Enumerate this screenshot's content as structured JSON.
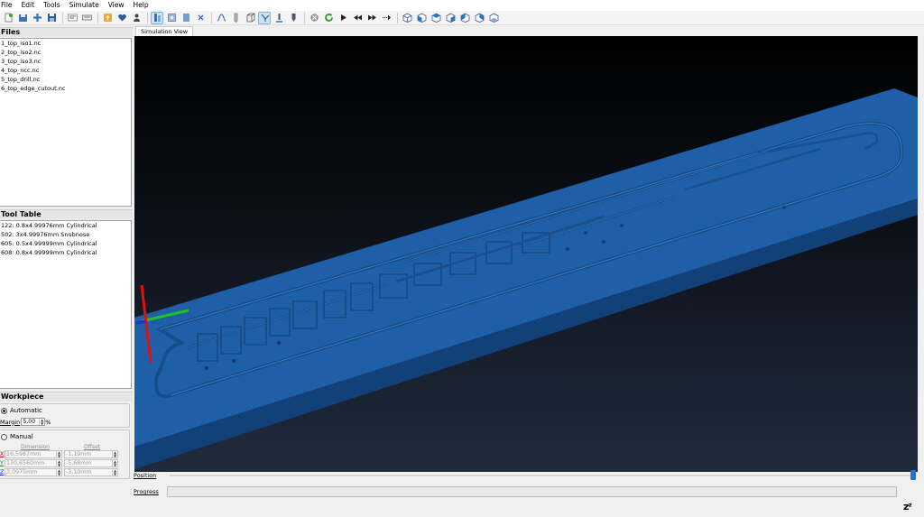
{
  "menu": [
    "File",
    "Edit",
    "Tools",
    "Simulate",
    "View",
    "Help"
  ],
  "toolbar": {
    "buttons": [
      "new-icon",
      "save-icon",
      "add-icon",
      "disk-icon",
      "gcode-icon",
      "keyboard-icon",
      "settings-icon",
      "heart-icon",
      "person-icon",
      "tool-icon",
      "workpiece-icon",
      "block-icon",
      "close-icon",
      "path-icon",
      "pencil-icon",
      "box-icon",
      "axes-icon",
      "endmill-icon",
      "drill-icon",
      "stop-icon",
      "reload-icon",
      "play-icon",
      "rewind-icon",
      "fast-forward-icon",
      "step-icon",
      "view-iso-icon",
      "view-front-icon",
      "view-top-icon",
      "view-left-icon",
      "view-right-icon",
      "view-back-icon",
      "view-bottom-icon"
    ],
    "accent": "#2a74c8"
  },
  "files": {
    "title": "Files",
    "items": [
      "1_top_iso1.nc",
      "2_top_iso2.nc",
      "3_top_iso3.nc",
      "4_top_ncc.nc",
      "5_top_drill.nc",
      "6_top_edge_cutout.nc"
    ]
  },
  "tools": {
    "title": "Tool Table",
    "items": [
      "122: 0.8x4.99976mm Cylindrical",
      "502: 3x4.99976mm Snubnose",
      "605: 0.5x4.99999mm Cylindrical",
      "608: 0.8x4.99999mm Cylindrical"
    ]
  },
  "workpiece": {
    "title": "Workpiece",
    "automatic_label": "Automatic",
    "margin_label": "Margin",
    "margin_value": "5,00",
    "margin_unit": "%",
    "manual_label": "Manual",
    "dimension_header": "Dimension",
    "offset_header": "Offset",
    "rows": [
      {
        "axis": "X",
        "dimension": "16,5987mm",
        "offset": "-1,19mm"
      },
      {
        "axis": "Y",
        "dimension": "130,6560mm",
        "offset": "-5,68mm"
      },
      {
        "axis": "Z",
        "dimension": "3,0975mm",
        "offset": "-3,10mm"
      }
    ]
  },
  "simulation": {
    "tab_label": "Simulation View",
    "board_color": "#1f5fa8"
  },
  "bottom": {
    "position_label": "Position",
    "position_value": 1.0,
    "progress_label": "Progress",
    "progress_value": 0,
    "status_glyph": "zᶻ"
  }
}
